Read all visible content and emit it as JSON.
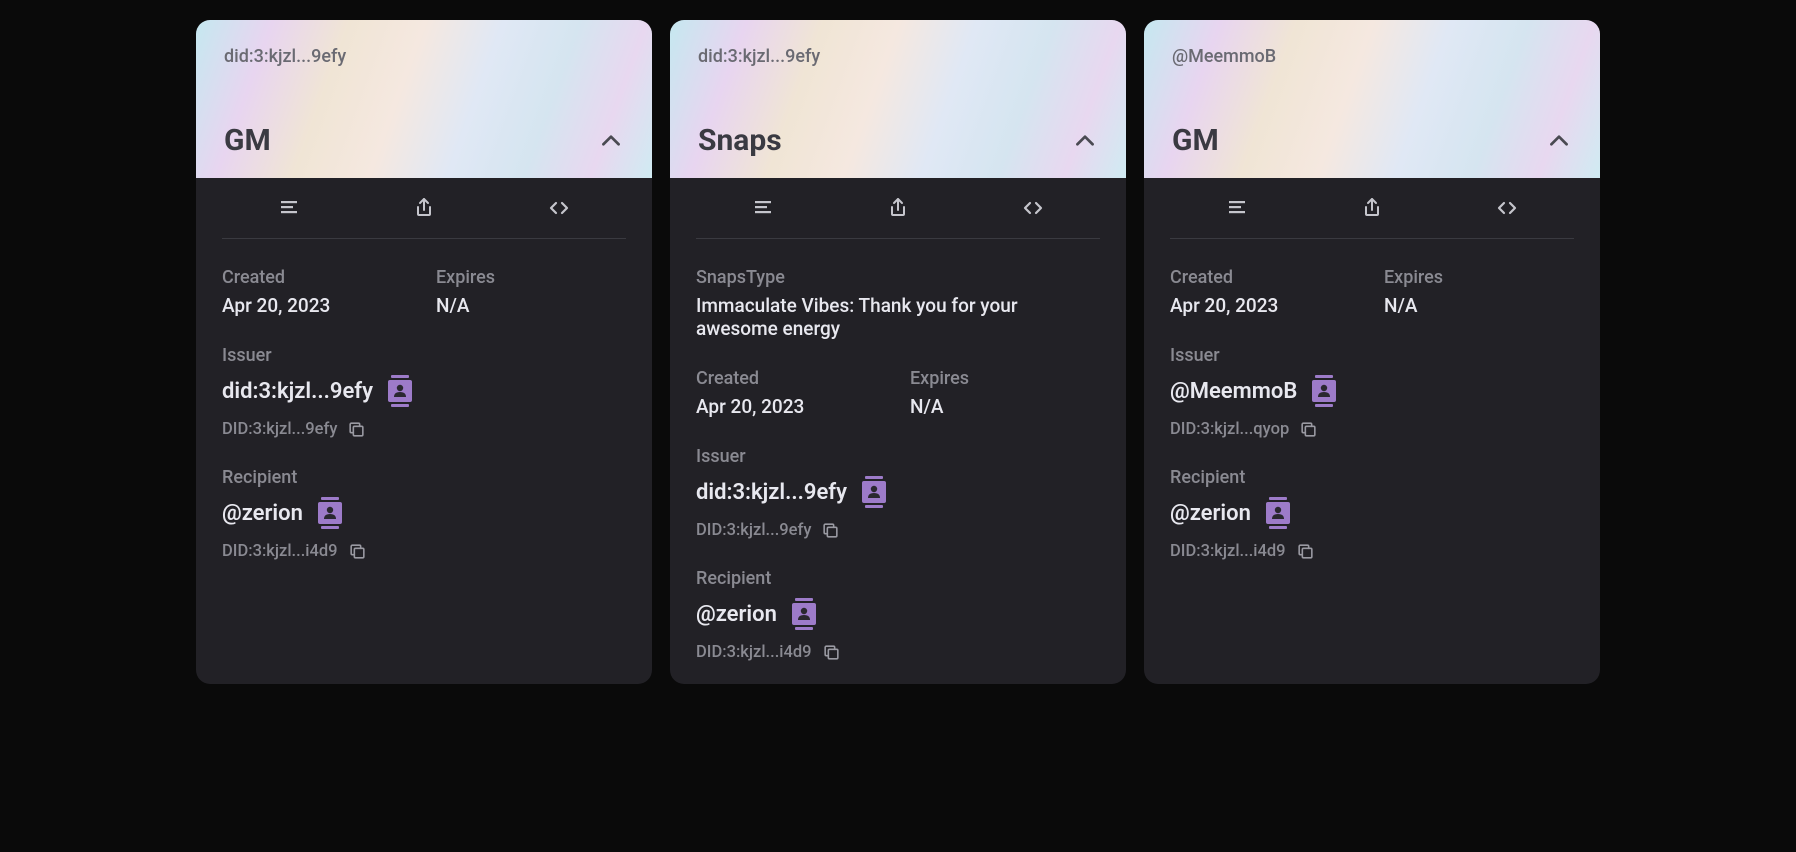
{
  "cards": [
    {
      "header_id": "did:3:kjzl...9efy",
      "title": "GM",
      "sections": [
        {
          "type": "row",
          "fields": [
            {
              "label": "Created",
              "value": "Apr 20, 2023"
            },
            {
              "label": "Expires",
              "value": "N/A"
            }
          ]
        },
        {
          "type": "identity",
          "label": "Issuer",
          "name": "did:3:kjzl...9efy",
          "did": "DID:3:kjzl...9efy"
        },
        {
          "type": "identity",
          "label": "Recipient",
          "name": "@zerion",
          "did": "DID:3:kjzl...i4d9"
        }
      ]
    },
    {
      "header_id": "did:3:kjzl...9efy",
      "title": "Snaps",
      "sections": [
        {
          "type": "full",
          "label": "SnapsType",
          "value": "Immaculate Vibes: Thank you for your awesome energy"
        },
        {
          "type": "row",
          "fields": [
            {
              "label": "Created",
              "value": "Apr 20, 2023"
            },
            {
              "label": "Expires",
              "value": "N/A"
            }
          ]
        },
        {
          "type": "identity",
          "label": "Issuer",
          "name": "did:3:kjzl...9efy",
          "did": "DID:3:kjzl...9efy"
        },
        {
          "type": "identity",
          "label": "Recipient",
          "name": "@zerion",
          "did": "DID:3:kjzl...i4d9"
        }
      ]
    },
    {
      "header_id": "@MeemmoB",
      "title": "GM",
      "sections": [
        {
          "type": "row",
          "fields": [
            {
              "label": "Created",
              "value": "Apr 20, 2023"
            },
            {
              "label": "Expires",
              "value": "N/A"
            }
          ]
        },
        {
          "type": "identity",
          "label": "Issuer",
          "name": "@MeemmoB",
          "did": "DID:3:kjzl...qyop"
        },
        {
          "type": "identity",
          "label": "Recipient",
          "name": "@zerion",
          "did": "DID:3:kjzl...i4d9"
        }
      ]
    }
  ],
  "colors": {
    "contact_icon": "#9d7bc9"
  }
}
